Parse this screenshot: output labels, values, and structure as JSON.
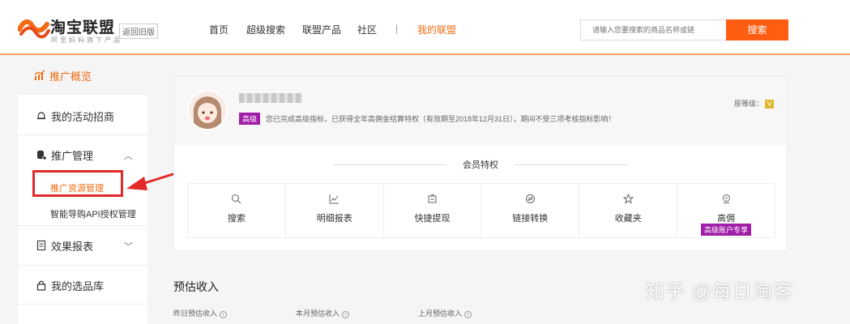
{
  "header": {
    "brand": "淘宝联盟",
    "brand_sub": "阿里妈妈旗下产品",
    "back_old": "返回旧版",
    "nav": [
      "首页",
      "超级搜索",
      "联盟产品",
      "社区",
      "我的联盟"
    ],
    "nav_sep": "|",
    "search_placeholder": "请输入您要搜索的商品名称或链",
    "search_button": "搜索",
    "colors": {
      "accent": "#f06b13",
      "search_btn": "#ff5d12"
    }
  },
  "sidebar": {
    "items": [
      {
        "label": "推广概览",
        "icon": "chart-icon"
      },
      {
        "label": "我的活动招商",
        "icon": "bell-icon"
      },
      {
        "label": "推广管理",
        "icon": "database-icon"
      },
      {
        "label": "效果报表",
        "icon": "document-icon"
      },
      {
        "label": "我的选品库",
        "icon": "lock-icon"
      }
    ],
    "sub_items": [
      "推广资源管理",
      "智能导购API授权管理"
    ]
  },
  "profile": {
    "badge": "高级",
    "notice": "您已完成高级指标，已获得全年高佣金结算特权（有效期至2018年12月31日），期间不受三项考核指标影响！",
    "level_label": "原等级：",
    "level_icon": "V"
  },
  "privileges": {
    "title": "会员特权",
    "items": [
      {
        "label": "搜索",
        "icon": "search-icon"
      },
      {
        "label": "明细报表",
        "icon": "line-chart-icon"
      },
      {
        "label": "快捷提现",
        "icon": "wallet-icon"
      },
      {
        "label": "链接转换",
        "icon": "convert-icon"
      },
      {
        "label": "收藏夹",
        "icon": "star-icon"
      },
      {
        "label": "高佣",
        "icon": "money-icon",
        "badge": "高级账户专享"
      }
    ]
  },
  "estimate": {
    "title": "预估收入",
    "items": [
      "昨日预估收入",
      "本月预估收入",
      "上月预估收入"
    ]
  },
  "watermark": "知乎 @每日淘客"
}
